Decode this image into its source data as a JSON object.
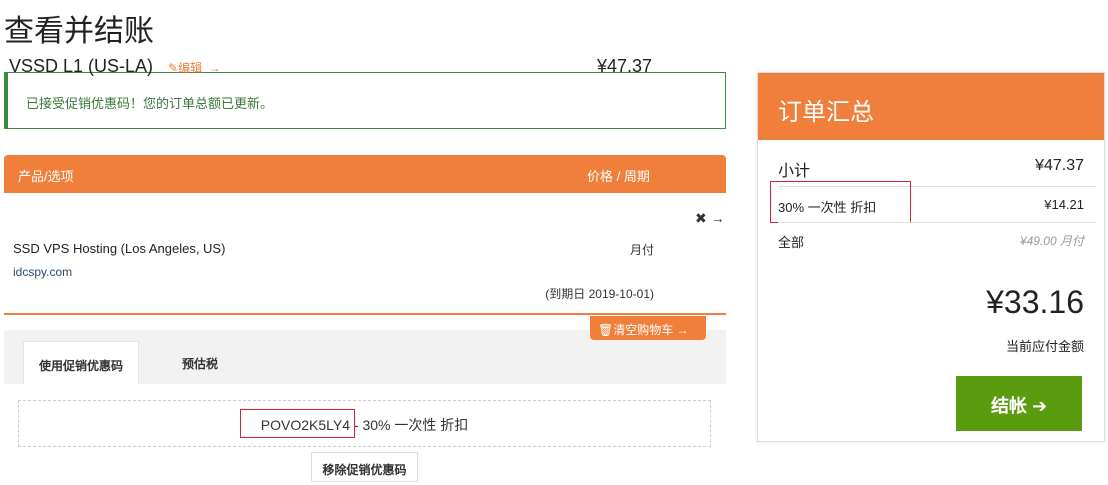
{
  "page_title": "查看并结账",
  "alert": "已接受促销优惠码！您的订单总额已更新。",
  "cart": {
    "col_product": "产品/选项",
    "col_price": "价格 / 周期",
    "item": {
      "name": "VSSD L1 (US-LA)",
      "edit": "编辑",
      "desc": "SSD VPS Hosting (Los Angeles, US)",
      "domain": "idcspy.com",
      "price": "¥47.37",
      "cycle": "月付",
      "due": "(到期日 2019-10-01)"
    },
    "empty_cart": "清空购物车"
  },
  "tabs": [
    {
      "label": "使用促销优惠码"
    },
    {
      "label": "预估税"
    }
  ],
  "promo": {
    "code": "POVO2K5LY4",
    "desc": "- 30% 一次性 折扣",
    "remove": "移除促销优惠码"
  },
  "summary": {
    "title": "订单汇总",
    "subtotal_label": "小计",
    "subtotal": "¥47.37",
    "discount_label": "30% 一次性 折扣",
    "discount": "¥14.21",
    "total_label": "全部",
    "recurring": "¥49.00 月付",
    "total": "¥33.16",
    "total_due_label": "当前应付金额",
    "checkout": "结帐"
  },
  "colors": {
    "accent": "#ef7f3a",
    "success": "#5a9b10"
  }
}
